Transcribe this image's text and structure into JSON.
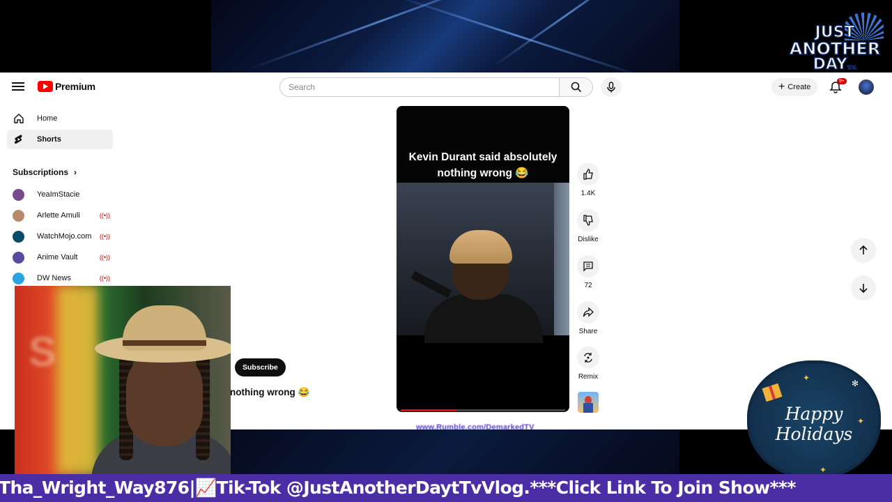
{
  "header": {
    "logo_text": "Premium",
    "search_placeholder": "Search",
    "create_label": "Create",
    "notification_count": "9+"
  },
  "sidebar": {
    "nav": [
      {
        "label": "Home",
        "icon": "home-icon"
      },
      {
        "label": "Shorts",
        "icon": "shorts-icon",
        "active": true
      }
    ],
    "subscriptions_title": "Subscriptions",
    "subscriptions": [
      {
        "name": "YeaImStacie",
        "live": false,
        "color": "#7a4a8e"
      },
      {
        "name": "Arlette Amuli",
        "live": true,
        "color": "#b88a6a"
      },
      {
        "name": "WatchMojo.com",
        "live": true,
        "color": "#0e4a6a"
      },
      {
        "name": "Anime Vault",
        "live": true,
        "color": "#5a4aa0"
      },
      {
        "name": "DW News",
        "live": true,
        "color": "#2aa3e0"
      }
    ],
    "live_icon": "live-broadcast-icon"
  },
  "short": {
    "caption": "Kevin Durant said absolutely nothing wrong 😂",
    "progress_fraction": 0.34,
    "actions": {
      "like_count": "1.4K",
      "dislike_label": "Dislike",
      "comment_count": "72",
      "share_label": "Share",
      "remix_label": "Remix"
    },
    "subscribe_label": "Subscribe",
    "title_partial": "nothing wrong 😂",
    "watermark": "www.Rumble.com/DemarkedTV"
  },
  "overlays": {
    "logo": {
      "line1": "JUST",
      "line2": "ANOTHER",
      "line3": "DAY",
      "tv": "T.V.",
      "tagline": "PODCASTS VLOGS & REVIEWS"
    },
    "holiday": {
      "line1": "Happy",
      "line2": "Holidays"
    },
    "ticker": "Tha_Wright_Way876|📈Tik-Tok @JustAnotherDaytTvVlog.***Click Link To Join Show***"
  },
  "colors": {
    "youtube_red": "#ff0000",
    "ticker_bg": "#4b2ea5",
    "live_red": "#cc0000"
  }
}
